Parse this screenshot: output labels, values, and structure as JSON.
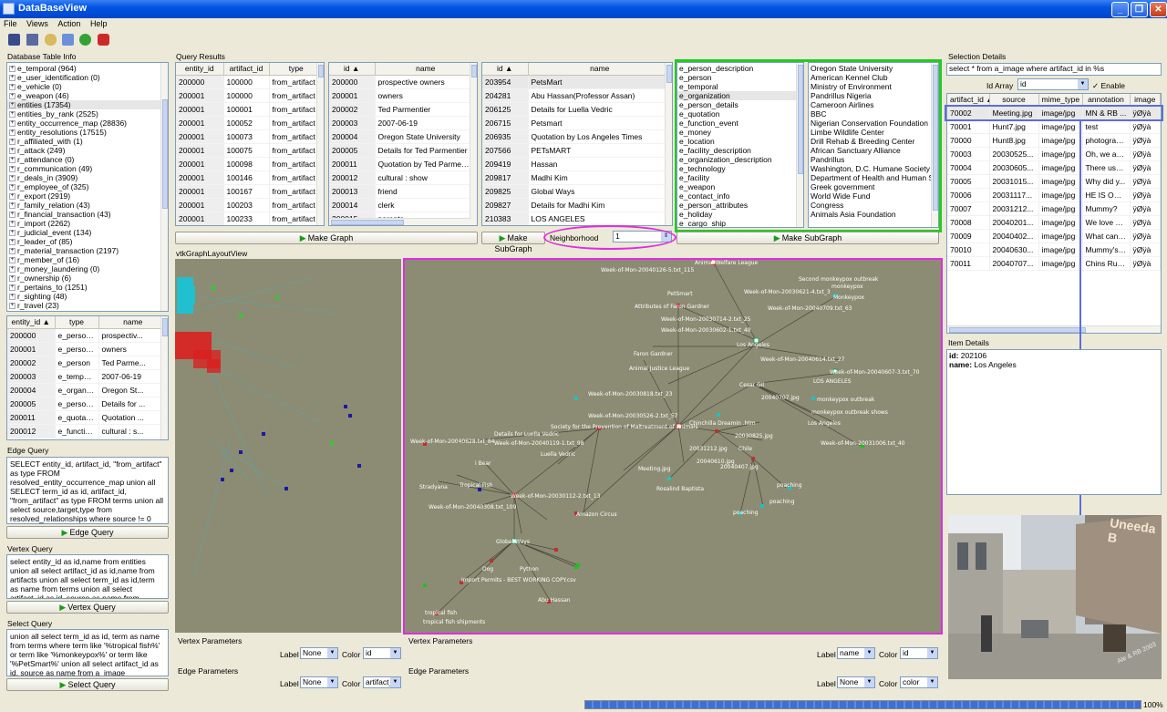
{
  "window": {
    "title": "DataBaseView"
  },
  "menu": [
    "File",
    "Views",
    "Action",
    "Help"
  ],
  "toolbar_icons": [
    "table-icon",
    "save-icon",
    "database-icon",
    "tools-icon",
    "help-icon",
    "stop-icon"
  ],
  "db_info": {
    "label": "Database Table Info",
    "items": [
      "e_temporal (964)",
      "e_user_identification (0)",
      "e_vehicle (0)",
      "e_weapon (46)",
      "entities (17354)",
      "entities_by_rank (2525)",
      "entity_occurrence_map (28836)",
      "entity_resolutions (17515)",
      "r_affiliated_with (1)",
      "r_attack (249)",
      "r_attendance (0)",
      "r_communication (49)",
      "r_deals_in (3909)",
      "r_employee_of (325)",
      "r_export (2919)",
      "r_family_relation (43)",
      "r_financial_transaction (43)",
      "r_import (2262)",
      "r_judicial_event (134)",
      "r_leader_of (85)",
      "r_material_transaction (2197)",
      "r_member_of (16)",
      "r_money_laundering (0)",
      "r_ownership (6)",
      "r_pertains_to (1251)",
      "r_sighting (48)",
      "r_travel (23)"
    ],
    "selected": "entities (17354)"
  },
  "entity_table": {
    "columns": [
      "entity_id",
      "type",
      "name"
    ],
    "rows": [
      [
        "200000",
        "e_person_...",
        "prospectiv..."
      ],
      [
        "200001",
        "e_person_...",
        "owners"
      ],
      [
        "200002",
        "e_person",
        "Ted Parme..."
      ],
      [
        "200003",
        "e_temporal",
        "2007-06-19"
      ],
      [
        "200004",
        "e_organiza...",
        "Oregon St..."
      ],
      [
        "200005",
        "e_person_...",
        "Details for ..."
      ],
      [
        "200011",
        "e_quotation",
        "Quotation ..."
      ],
      [
        "200012",
        "e_function...",
        "cultural : s..."
      ]
    ]
  },
  "edge_query": {
    "label": "Edge Query",
    "text": "SELECT entity_id, artifact_id, \"from_artifact\" as type   FROM resolved_entity_occurrence_map union all  SELECT term_id as id, artifact_id, \"from_artifact\" as type    FROM terms   union all select source,target,type          from resolved_relationships         where source != 0 and target != 0",
    "button": "Edge Query"
  },
  "vertex_query": {
    "label": "Vertex Query",
    "text": "select entity_id as id,name from entities union all  select artifact_id as id,name from artifacts union all select term_id as id,term as name from terms union all  select artifact_id as id, source as name from a_image",
    "button": "Vertex Query"
  },
  "select_query": {
    "label": "Select Query",
    "text": "union all select term_id as id, term as name from terms where term like '%tropical fish%' or term like '%monkeypox%'  or term like '%PetSmart%' union all select artifact_id as id, source as name from a_image",
    "button": "Select Query"
  },
  "query_results": {
    "label": "Query Results",
    "table1": {
      "columns": [
        "entity_id",
        "artifact_id",
        "type"
      ],
      "rows": [
        [
          "200000",
          "100000",
          "from_artifact"
        ],
        [
          "200001",
          "100000",
          "from_artifact"
        ],
        [
          "200001",
          "100001",
          "from_artifact"
        ],
        [
          "200001",
          "100052",
          "from_artifact"
        ],
        [
          "200001",
          "100073",
          "from_artifact"
        ],
        [
          "200001",
          "100075",
          "from_artifact"
        ],
        [
          "200001",
          "100098",
          "from_artifact"
        ],
        [
          "200001",
          "100146",
          "from_artifact"
        ],
        [
          "200001",
          "100167",
          "from_artifact"
        ],
        [
          "200001",
          "100203",
          "from_artifact"
        ],
        [
          "200001",
          "100233",
          "from_artifact"
        ]
      ]
    },
    "table2": {
      "columns": [
        "id",
        "name"
      ],
      "rows": [
        [
          "200000",
          "prospective owners"
        ],
        [
          "200001",
          "owners"
        ],
        [
          "200002",
          "Ted Parmentier"
        ],
        [
          "200003",
          "2007-06-19"
        ],
        [
          "200004",
          "Oregon State University"
        ],
        [
          "200005",
          "Details for Ted Parmentier"
        ],
        [
          "200011",
          "Quotation by Ted Parmentier"
        ],
        [
          "200012",
          "cultural : show"
        ],
        [
          "200013",
          "friend"
        ],
        [
          "200014",
          "clerk"
        ],
        [
          "200015",
          "parents"
        ]
      ]
    },
    "table3": {
      "columns": [
        "id",
        "name"
      ],
      "rows": [
        [
          "203954",
          "PetsMart"
        ],
        [
          "204281",
          "Abu Hassan(Professor Assan)"
        ],
        [
          "206125",
          "Details for Luella Vedric"
        ],
        [
          "206715",
          "Petsmart"
        ],
        [
          "206935",
          "Quotation by Los Angeles Times"
        ],
        [
          "207566",
          "PETsMART"
        ],
        [
          "209419",
          "Hassan"
        ],
        [
          "209817",
          "Madhi Kim"
        ],
        [
          "209825",
          "Global Ways"
        ],
        [
          "209827",
          "Details for Madhi Kim"
        ],
        [
          "210383",
          "LOS ANGELES"
        ]
      ]
    },
    "type_list": [
      "e_person_description",
      "e_person",
      "e_temporal",
      "e_organization",
      "e_person_details",
      "e_quotation",
      "e_function_event",
      "e_money",
      "e_location",
      "e_facility_description",
      "e_organization_description",
      "e_technology",
      "e_facility",
      "e_weapon",
      "e_contact_info",
      "e_person_attributes",
      "e_holiday",
      "e_cargo_ship"
    ],
    "type_selected": "e_organization",
    "name_list": [
      "Oregon State University",
      "American Kennel Club",
      "Ministry of Environment",
      "Pandrillus Nigeria",
      "Cameroon Airlines",
      "BBC",
      "Nigerian  Conservation Foundation",
      "Limbe  Wildlife Center",
      "Drill Rehab & Breeding Center",
      "African Sanctuary Alliance",
      "Pandrillus",
      "Washington, D.C. Humane Society",
      "Department of Health and Human Se",
      "Greek  government",
      "World Wide Fund",
      "Congress",
      "Animals  Asia Foundation"
    ],
    "make_graph": "Make Graph",
    "make_subgraph": "Make SubGraph",
    "neighborhood_label": "Neighborhood",
    "neighborhood_value": "1",
    "make_subgraph2": "Make SubGraph"
  },
  "graph_view": {
    "label": "vtkGraphLayoutView",
    "nodes": [
      "Week-of-Mon-20040126-5.txt_115",
      "PetSmart",
      "Attributes of Faron Gardner",
      "Animal Welfare League",
      "Second monkeypox outbreak",
      "monkeypox",
      "Week-of-Mon-20030621-4.txt_3",
      "Monkeypox",
      "Week-of-Mon-20040709.txt_63",
      "Week-of-Mon-20030714-2.txt_25",
      "Week-of-Mon-20030602-1.txt_40",
      "Los Angeles",
      "Faron Gardner",
      "Animal Justice League",
      "Week-of-Mon-20040614.txt_27",
      "Week-of-Mon-20040607-3.txt_70",
      "LOS ANGELES",
      "Cesar Gil",
      "20040707.jpg",
      "monkeypox outbreak",
      "Week-of-Mon-20030818.txt_23",
      "monkeypox outbreak shows",
      "Los Angeles",
      "Week-of-Mon-20030526-2.txt_57",
      "Society for the Prevention of Maltreatment of Animals",
      "Chinchilla Dreamin .htm",
      "20030825.jpg",
      "Details for Luella Vedric",
      "Week-of-Mon-20040628.txt_84",
      "Week-of-Mon-20040119-1.txt_98",
      "Luella Vedric",
      "Week-of-Mon-20031006.txt_40",
      "20031212.jpg",
      "Chile",
      "i Bear",
      "20040610.jpg",
      "Meeting.jpg",
      "20040407.jpg",
      "Tropical Fish",
      "Week-of-Mon-20030112-2.txt_13",
      "Stradyana",
      "Rosalind Baptista",
      "poaching",
      "Week-of-Mon-20040308.txt_109",
      "poaching",
      "Amazon Circus",
      "poaching",
      "Global Ways",
      "Dog",
      "Python",
      "Import Permits - BEST WORKING COPY.csv",
      "Abu Hassan",
      "tropical fish",
      "tropical fish shipments"
    ]
  },
  "vertex_params": {
    "label": "Vertex Parameters",
    "label_lbl": "Label",
    "label_val": "None",
    "color_lbl": "Color",
    "color_val": "id"
  },
  "edge_params": {
    "label": "Edge Parameters",
    "label_lbl": "Label",
    "label_val": "None",
    "color_lbl": "Color",
    "color_val": "artifact_"
  },
  "vertex_params2": {
    "label": "Vertex Parameters",
    "label_lbl": "Label",
    "label_val": "name",
    "color_lbl": "Color",
    "color_val": "id"
  },
  "edge_params2": {
    "label": "Edge Parameters",
    "label_lbl": "Label",
    "label_val": "None",
    "color_lbl": "Color",
    "color_val": "color"
  },
  "selection": {
    "label": "Selection Details",
    "query": "select * from a_image where artifact_id in %s",
    "array_label": "Id Array",
    "array_value": "id",
    "enable_label": "Enable",
    "columns": [
      "artifact_id",
      "source",
      "mime_type",
      "annotation",
      "image"
    ],
    "rows": [
      [
        "70002",
        "Meeting.jpg",
        "image/jpg",
        "MN & RB ...",
        "ÿØÿà"
      ],
      [
        "70001",
        "Hunt7.jpg",
        "image/jpg",
        "test",
        "ÿØÿà"
      ],
      [
        "70000",
        "Hunt8.jpg",
        "image/jpg",
        "photograp...",
        "ÿØÿà"
      ],
      [
        "70003",
        "20030525...",
        "image/jpg",
        "Oh, we are...",
        "ÿØÿà"
      ],
      [
        "70004",
        "20030605...",
        "image/jpg",
        "There used...",
        "ÿØÿà"
      ],
      [
        "70005",
        "20031015...",
        "image/jpg",
        "Why did y...",
        "ÿØÿà"
      ],
      [
        "70006",
        "20031117...",
        "image/jpg",
        "HE IS OUR...",
        "ÿØÿà"
      ],
      [
        "70007",
        "20031212...",
        "image/jpg",
        "Mummy?",
        "ÿØÿà"
      ],
      [
        "70008",
        "20040201...",
        "image/jpg",
        "We love ou...",
        "ÿØÿà"
      ],
      [
        "70009",
        "20040402...",
        "image/jpg",
        "What can o...",
        "ÿØÿà"
      ],
      [
        "70010",
        "20040630...",
        "image/jpg",
        "Mummy's ...",
        "ÿØÿà"
      ],
      [
        "70011",
        "20040707...",
        "image/jpg",
        "Chins Rule!...",
        "ÿØÿà"
      ]
    ]
  },
  "item_details": {
    "label": "Item Details",
    "id_label": "id:",
    "id_value": "202106",
    "name_label": "name:",
    "name_value": "Los Angeles"
  },
  "photo": {
    "signage": "Uneeda B",
    "signature": "Ale & RB 2003"
  },
  "status": {
    "progress_percent": 100,
    "progress_text": "100%"
  },
  "colors": {
    "highlight_green": "#22cc22",
    "highlight_magenta": "#e02de0",
    "selection_blue": "#5b6fd6",
    "graph_bg": "#8c8c74"
  }
}
